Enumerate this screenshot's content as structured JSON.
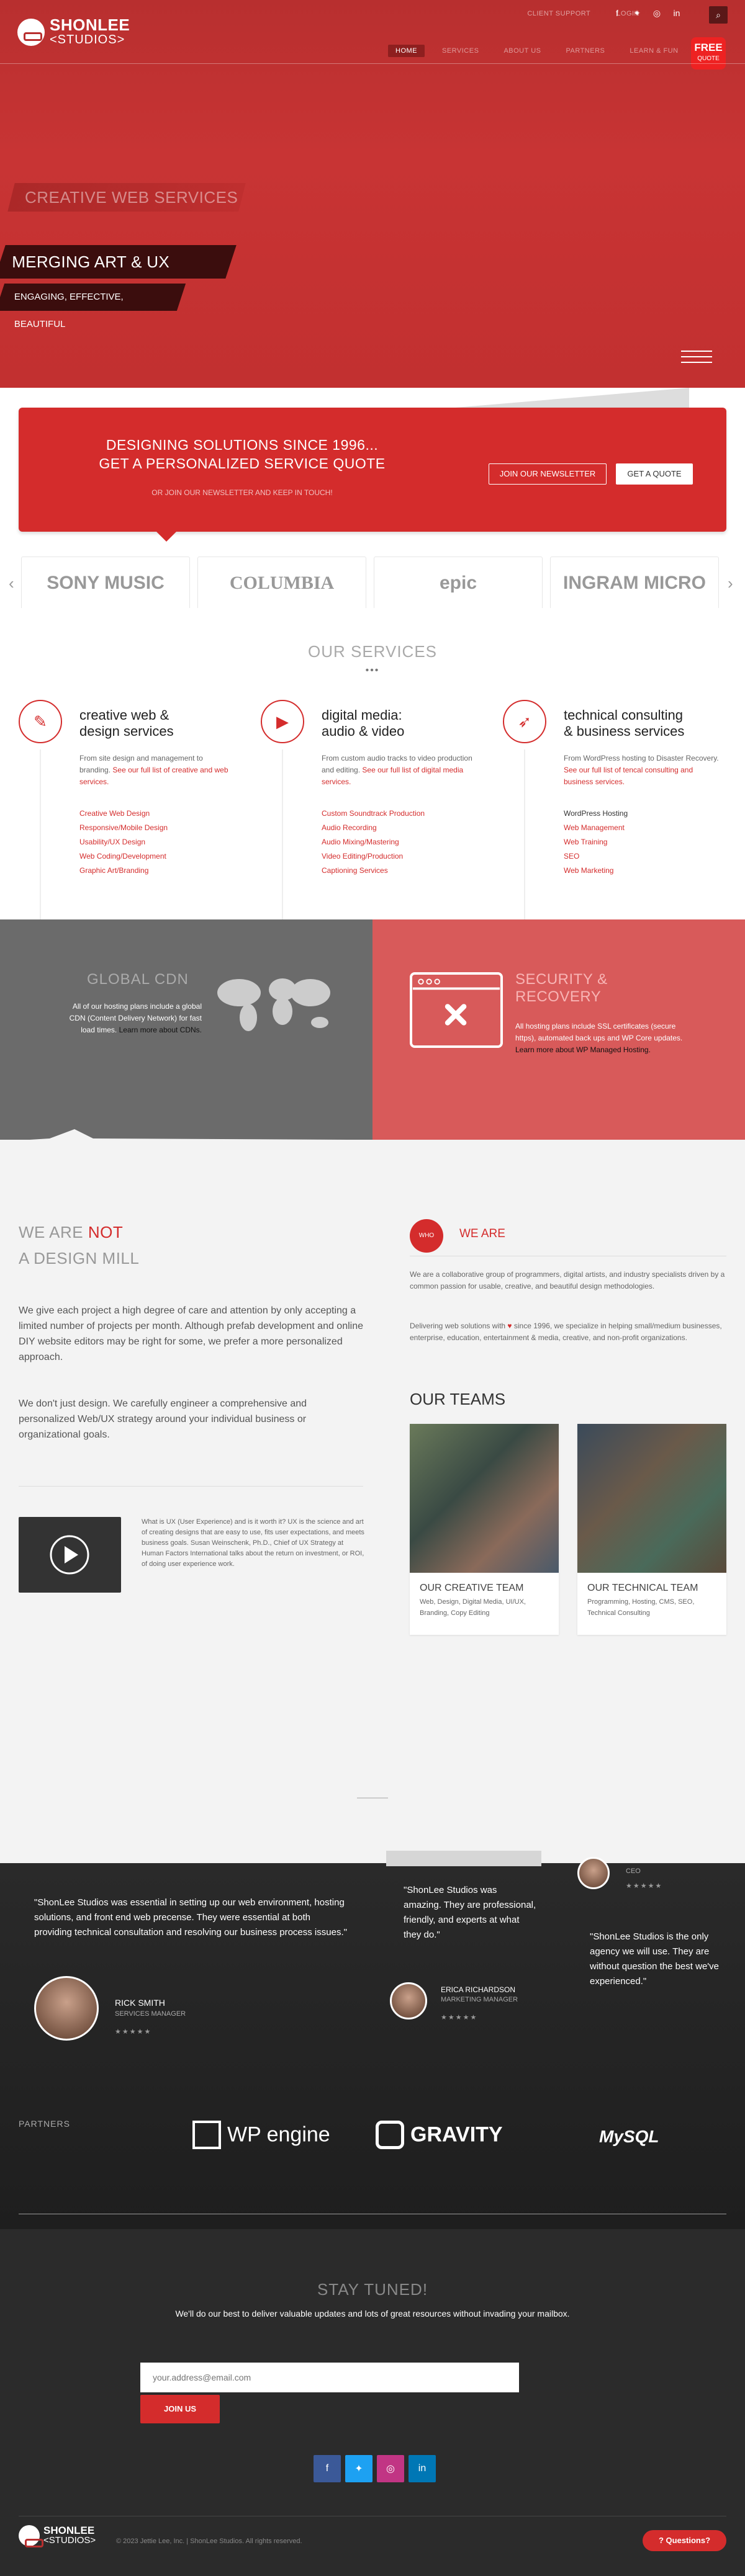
{
  "header": {
    "logo_line1": "SHONLEE",
    "logo_line2": "<STUDIOS>",
    "top_links": [
      "CLIENT SUPPORT",
      "LOGIN"
    ],
    "nav": [
      "HOME",
      "SERVICES",
      "ABOUT US",
      "PARTNERS",
      "LEARN & FUN"
    ],
    "free_quote_line1": "FREE",
    "free_quote_line2": "QUOTE"
  },
  "hero": {
    "banner1": "CREATIVE WEB SERVICES",
    "banner2": "MERGING ART & UX DESIGN",
    "banner3": "ENGAGING, EFFECTIVE, BEAUTIFUL"
  },
  "quote": {
    "title_line1": "DESIGNING SOLUTIONS SINCE 1996...",
    "title_line2": "GET A PERSONALIZED SERVICE QUOTE",
    "subtitle": "OR JOIN OUR NEWSLETTER AND KEEP IN TOUCH!",
    "newsletter_btn": "JOIN OUR NEWSLETTER",
    "quote_btn": "GET A QUOTE"
  },
  "clients": [
    "SONY MUSIC",
    "COLUMBIA",
    "epic",
    "INGRAM MICRO"
  ],
  "services": {
    "title": "OUR SERVICES",
    "dots": "•••",
    "items": [
      {
        "title_line1": "creative web &",
        "title_line2": "design services",
        "desc": "From site design and management to branding.",
        "desc_link": "See our full list of creative and web services.",
        "list": [
          "Creative Web Design",
          "Responsive/Mobile Design",
          "Usability/UX Design",
          "Web Coding/Development",
          "Graphic Art/Branding"
        ]
      },
      {
        "title_line1": "digital media:",
        "title_line2": "audio & video",
        "desc": "From custom audio tracks to video production and editing.",
        "desc_link": "See our full list of digital media services.",
        "list": [
          "Custom Soundtrack Production",
          "Audio Recording",
          "Audio Mixing/Mastering",
          "Video Editing/Production",
          "Captioning Services"
        ]
      },
      {
        "title_line1": "technical consulting",
        "title_line2": "& business services",
        "desc": "From WordPress hosting to Disaster Recovery.",
        "desc_link": "See our full list of tencal consulting and business services.",
        "list": [
          "WordPress Hosting",
          "Web Management",
          "Web Training",
          "SEO",
          "Web Marketing"
        ]
      }
    ]
  },
  "cdn": {
    "title": "GLOBAL CDN",
    "text": "All of our hosting plans include a global CDN (Content Delivery Network) for fast load times.",
    "link": "Learn more about CDNs."
  },
  "security": {
    "title_line1": "SECURITY &",
    "title_line2": "RECOVERY",
    "text": "All hosting plans include SSL certificates (secure https), automated back ups and WP Core updates.",
    "link": "Learn more about WP Managed Hosting."
  },
  "about": {
    "h1_part1": "WE ARE",
    "h1_part2": "NOT",
    "h1_line2": "A DESIGN MILL",
    "p1": "We give each project a high degree of care and attention by only accepting a limited number of projects per month. Although prefab development and online DIY website editors may be right for some, we prefer a more personalized approach.",
    "p2": "We don't just design. We carefully engineer a comprehensive and personalized Web/UX strategy around your individual business or organizational goals.",
    "video_text": "What is UX (User Experience) and is it worth it? UX is the science and art of creating designs that are easy to use, fits user expectations, and meets business goals. Susan Weinschenk, Ph.D., Chief of UX Strategy at Human Factors International talks about the return on investment, or ROI, of doing user experience work."
  },
  "who": {
    "badge": "WHO",
    "title": "WE ARE",
    "p1": "We are a collaborative group of programmers, digital artists, and industry specialists driven by a common passion for usable, creative, and beautiful design methodologies.",
    "p2_a": "Delivering web solutions with",
    "p2_b": "since 1996, we specialize in helping small/medium businesses, enterprise, education, entertainment & media, creative, and non-profit organizations.",
    "teams_title": "OUR TEAMS",
    "teams": [
      {
        "name": "OUR CREATIVE TEAM",
        "desc": "Web, Design, Digital Media, UI/UX, Branding, Copy Editing"
      },
      {
        "name": "OUR TECHNICAL TEAM",
        "desc": "Programming, Hosting, CMS, SEO, Technical Consulting"
      }
    ]
  },
  "testimonials": [
    {
      "quote": "\"ShonLee Studios was essential in setting up our web environment, hosting solutions, and front end web precense. They were essential at both providing technical consultation and resolving our business process issues.\"",
      "name": "RICK SMITH",
      "role": "SERVICES MANAGER",
      "stars": "★★★★★"
    },
    {
      "quote": "\"ShonLee Studios was amazing. They are professional, friendly, and experts at what they do.\"",
      "name": "ERICA RICHARDSON",
      "role": "MARKETING MANAGER",
      "stars": "★★★★★"
    },
    {
      "quote": "\"ShonLee Studios is the only agency we will use. They are without question the best we've experienced.\"",
      "name": "",
      "role": "CEO",
      "stars": "★★★★★"
    }
  ],
  "partners": {
    "label": "PARTNERS",
    "items": [
      "WP engine",
      "GRAVITY",
      "MySQL"
    ]
  },
  "footer": {
    "stay_title": "STAY TUNED!",
    "stay_text": "We'll do our best to deliver valuable updates and lots of great resources without invading your mailbox.",
    "email_placeholder": "your.address@email.com",
    "join": "JOIN US",
    "copyright": "© 2023 Jettie Lee, Inc. | ShonLee Studios. All rights reserved.",
    "questions": "Questions?",
    "logo_line1": "SHONLEE",
    "logo_line2": "<STUDIOS>"
  },
  "colors": {
    "brand_red": "#d42c2c",
    "dark": "#2b2b2b",
    "gray": "#6b6b6b"
  }
}
